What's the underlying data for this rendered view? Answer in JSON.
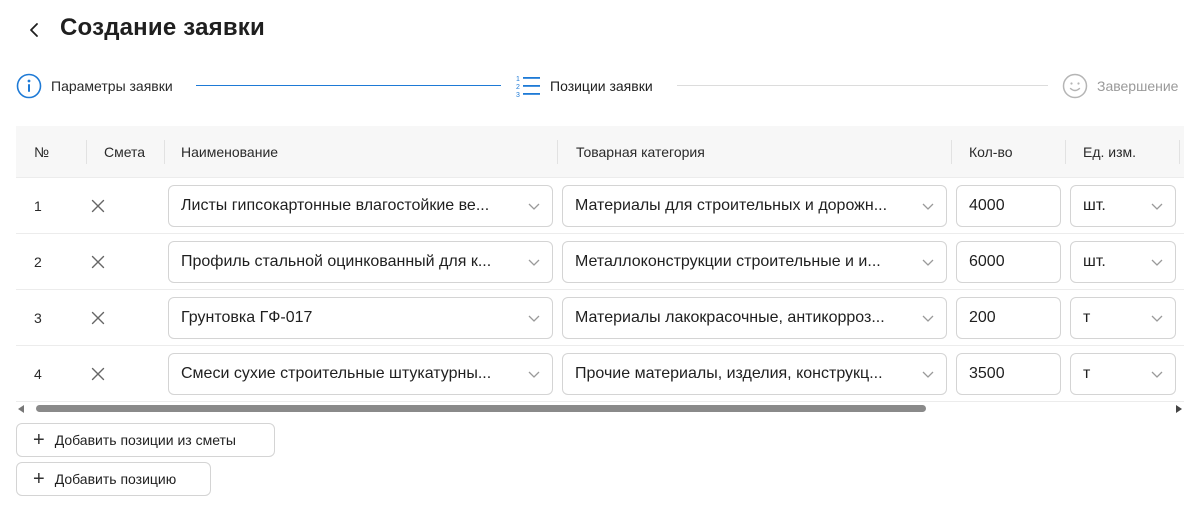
{
  "header": {
    "title": "Создание заявки"
  },
  "colors": {
    "accent": "#1e7ad6",
    "inactive": "#9a9a9a",
    "border": "#d4d4d4"
  },
  "steps": [
    {
      "label": "Параметры заявки",
      "icon": "info-icon",
      "state": "done"
    },
    {
      "label": "Позиции заявки",
      "icon": "list-numbered-icon",
      "state": "active"
    },
    {
      "label": "Завершение",
      "icon": "smile-icon",
      "state": "upcoming"
    }
  ],
  "table": {
    "columns": {
      "num": "№",
      "estimate": "Смета",
      "name": "Наименование",
      "category": "Товарная категория",
      "qty": "Кол-во",
      "unit": "Ед. изм."
    },
    "rows": [
      {
        "num": "1",
        "name": "Листы гипсокартонные влагостойкие ве...",
        "category": "Материалы для строительных и дорожн...",
        "qty": "4000",
        "unit": "шт."
      },
      {
        "num": "2",
        "name": "Профиль стальной оцинкованный для к...",
        "category": "Металлоконструкции строительные и и...",
        "qty": "6000",
        "unit": "шт."
      },
      {
        "num": "3",
        "name": "Грунтовка ГФ-017",
        "category": "Материалы лакокрасочные, антикорроз...",
        "qty": "200",
        "unit": "т"
      },
      {
        "num": "4",
        "name": "Смеси сухие строительные штукатурны...",
        "category": "Прочие материалы, изделия, конструкц...",
        "qty": "3500",
        "unit": "т"
      }
    ]
  },
  "actions": {
    "add_from_estimate": "Добавить позиции из сметы",
    "add_position": "Добавить позицию"
  }
}
